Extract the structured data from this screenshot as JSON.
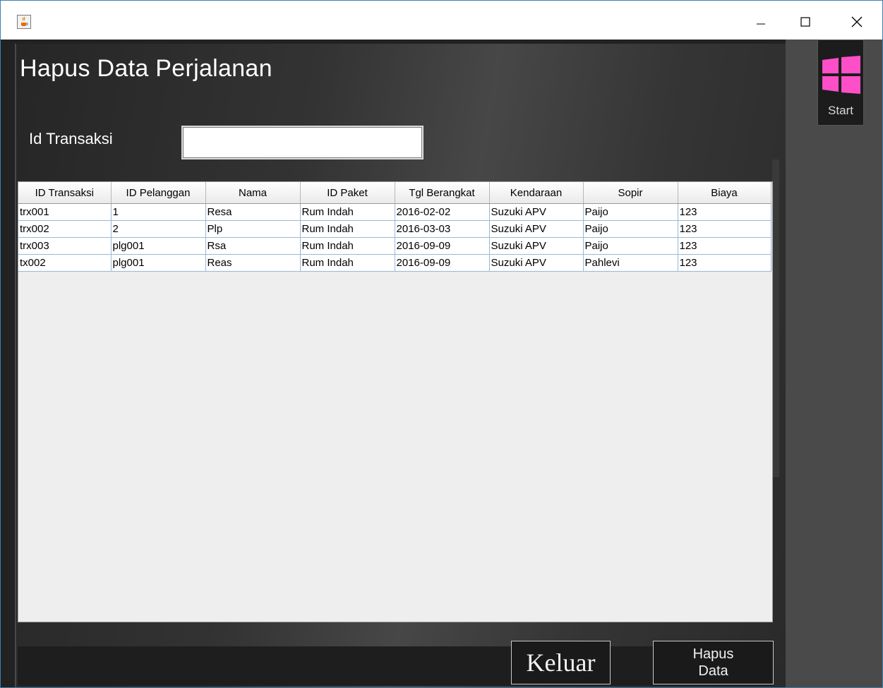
{
  "window": {
    "title": "",
    "icons": {
      "app": "java-cup-icon",
      "minimize": "minimize-icon",
      "maximize": "maximize-icon",
      "close": "close-icon"
    }
  },
  "page": {
    "title": "Hapus Data Perjalanan",
    "field_label": "Id Transaksi",
    "field_value": ""
  },
  "sidebar": {
    "start_label": "Start",
    "start_icon": "windows-logo-icon",
    "accent": "#ff4fc8"
  },
  "table": {
    "columns": [
      "ID Transaksi",
      "ID Pelanggan",
      "Nama",
      "ID Paket",
      "Tgl Berangkat",
      "Kendaraan",
      "Sopir",
      "Biaya"
    ],
    "rows": [
      [
        "trx001",
        "1",
        "Resa",
        "Rum Indah",
        "2016-02-02",
        "Suzuki APV",
        "Paijo",
        "123"
      ],
      [
        "trx002",
        "2",
        "Plp",
        "Rum Indah",
        "2016-03-03",
        "Suzuki APV",
        "Paijo",
        "123"
      ],
      [
        "trx003",
        "plg001",
        "Rsa",
        "Rum Indah",
        "2016-09-09",
        "Suzuki APV",
        "Paijo",
        "123"
      ],
      [
        "tx002",
        "plg001",
        "Reas",
        "Rum Indah",
        "2016-09-09",
        "Suzuki APV",
        "Pahlevi",
        "123"
      ]
    ]
  },
  "buttons": {
    "keluar": "Keluar",
    "hapus_line1": "Hapus",
    "hapus_line2": "Data"
  }
}
